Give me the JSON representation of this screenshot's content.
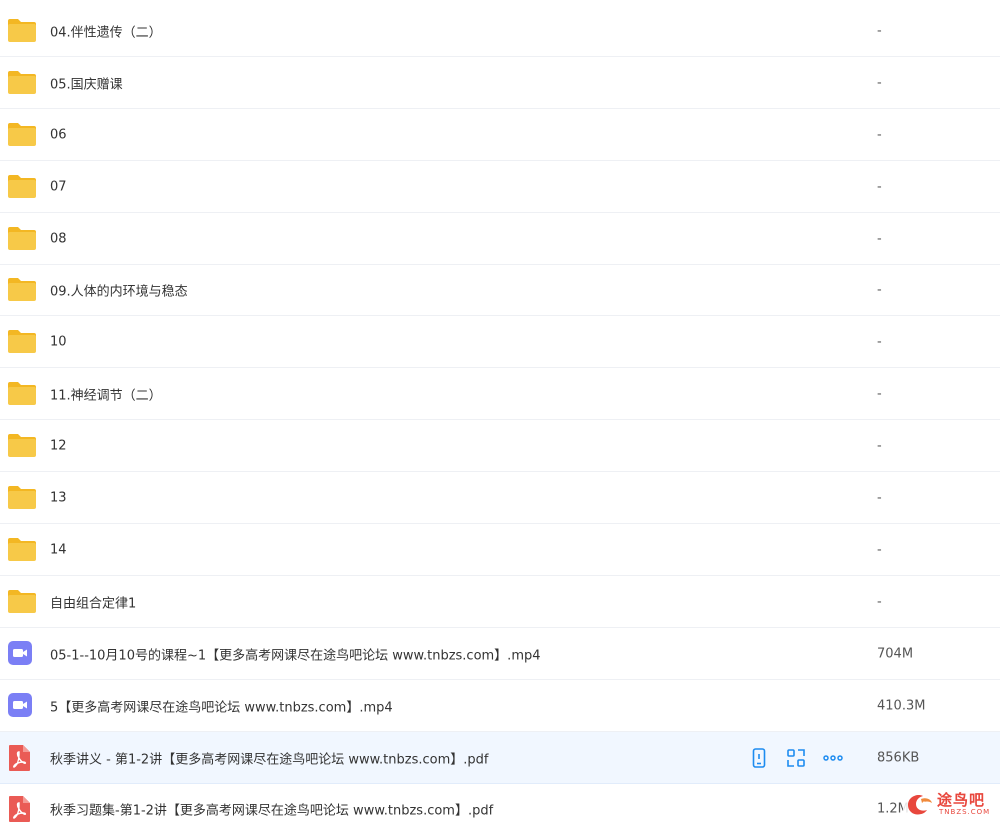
{
  "colors": {
    "folder": "#f7c948",
    "folder_tab": "#f3b723",
    "video": "#7b7ff5",
    "pdf": "#ea5b55",
    "action": "#1d8cf0",
    "hover_bg": "#f1f7ff"
  },
  "rows": [
    {
      "type": "folder",
      "name": "04.伴性遗传（二）",
      "size": "-"
    },
    {
      "type": "folder",
      "name": "05.国庆赠课",
      "size": "-"
    },
    {
      "type": "folder",
      "name": "06",
      "size": "-"
    },
    {
      "type": "folder",
      "name": "07",
      "size": "-"
    },
    {
      "type": "folder",
      "name": "08",
      "size": "-"
    },
    {
      "type": "folder",
      "name": "09.人体的内环境与稳态",
      "size": "-"
    },
    {
      "type": "folder",
      "name": "10",
      "size": "-"
    },
    {
      "type": "folder",
      "name": "11.神经调节（二）",
      "size": "-"
    },
    {
      "type": "folder",
      "name": "12",
      "size": "-"
    },
    {
      "type": "folder",
      "name": "13",
      "size": "-"
    },
    {
      "type": "folder",
      "name": "14",
      "size": "-"
    },
    {
      "type": "folder",
      "name": "自由组合定律1",
      "size": "-"
    },
    {
      "type": "video",
      "name": "05-1--10月10号的课程~1【更多高考网课尽在途鸟吧论坛 www.tnbzs.com】.mp4",
      "size": "704M"
    },
    {
      "type": "video",
      "name": "5【更多高考网课尽在途鸟吧论坛 www.tnbzs.com】.mp4",
      "size": "410.3M"
    },
    {
      "type": "pdf",
      "name": "秋季讲义 - 第1-2讲【更多高考网课尽在途鸟吧论坛 www.tnbzs.com】.pdf",
      "size": "856KB",
      "hover": true
    },
    {
      "type": "pdf",
      "name": "秋季习题集-第1-2讲【更多高考网课尽在途鸟吧论坛 www.tnbzs.com】.pdf",
      "size": "1.2M"
    }
  ],
  "row_actions": [
    {
      "icon": "mobile-phone-icon"
    },
    {
      "icon": "share-icon"
    },
    {
      "icon": "more-dots-icon"
    }
  ],
  "watermark": {
    "text": "途鸟吧",
    "sub": "TNBZS.COM",
    "icon": "bird-logo-icon"
  }
}
